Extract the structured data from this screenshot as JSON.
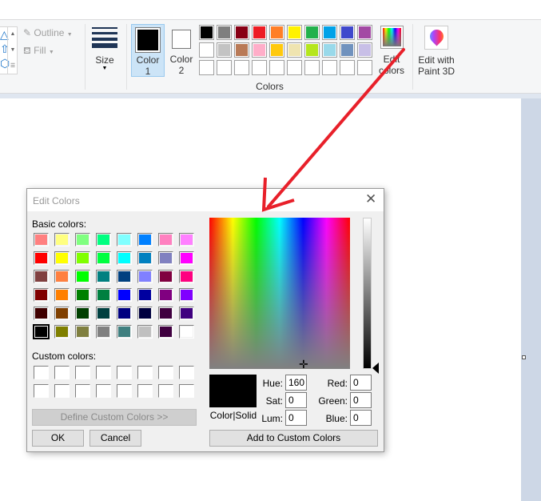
{
  "ribbon": {
    "outline_label": "Outline",
    "fill_label": "Fill",
    "size_label": "Size",
    "color1_label": [
      "Color",
      "1"
    ],
    "color2_label": [
      "Color",
      "2"
    ],
    "colors_group_label": "Colors",
    "edit_colors_label": [
      "Edit",
      "colors"
    ],
    "paint3d_label": [
      "Edit with",
      "Paint 3D"
    ],
    "color1": "#000000",
    "color2": "#ffffff",
    "palette": [
      [
        "#000000",
        "#7f7f7f",
        "#880015",
        "#ed1c24",
        "#ff7f27",
        "#fff200",
        "#22b14c",
        "#00a2e8",
        "#3f48cc",
        "#a349a4"
      ],
      [
        "#ffffff",
        "#c3c3c3",
        "#b97a57",
        "#ffaec9",
        "#ffc90e",
        "#efe4b0",
        "#b5e61d",
        "#99d9ea",
        "#7092be",
        "#c8bfe7"
      ],
      [
        "",
        "",
        "",
        "",
        "",
        "",
        "",
        "",
        "",
        ""
      ]
    ]
  },
  "dialog": {
    "title": "Edit Colors",
    "basic_colors_label": "Basic colors:",
    "basic_colors": [
      [
        "#ff8080",
        "#ffff80",
        "#80ff80",
        "#00ff80",
        "#80ffff",
        "#0080ff",
        "#ff80c0",
        "#ff80ff"
      ],
      [
        "#ff0000",
        "#ffff00",
        "#80ff00",
        "#00ff40",
        "#00ffff",
        "#0080c0",
        "#8080c0",
        "#ff00ff"
      ],
      [
        "#804040",
        "#ff8040",
        "#00ff00",
        "#008080",
        "#004080",
        "#8080ff",
        "#800040",
        "#ff0080"
      ],
      [
        "#800000",
        "#ff8000",
        "#008000",
        "#008040",
        "#0000ff",
        "#0000a0",
        "#800080",
        "#8000ff"
      ],
      [
        "#400000",
        "#804000",
        "#004000",
        "#004040",
        "#000080",
        "#000040",
        "#400040",
        "#400080"
      ],
      [
        "#000000",
        "#808000",
        "#808040",
        "#808080",
        "#408080",
        "#c0c0c0",
        "#400040",
        "#ffffff"
      ]
    ],
    "selected_basic": "#000000",
    "custom_colors_label": "Custom colors:",
    "define_button": "Define Custom Colors >>",
    "ok_button": "OK",
    "cancel_button": "Cancel",
    "preview_label": "Color|Solid",
    "hue_label": "Hue:",
    "hue": "160",
    "sat_label": "Sat:",
    "sat": "0",
    "lum_label": "Lum:",
    "lum": "0",
    "red_label": "Red:",
    "red": "0",
    "green_label": "Green:",
    "green": "0",
    "blue_label": "Blue:",
    "blue": "0",
    "add_button": "Add to Custom Colors",
    "current_color": "#000000"
  },
  "annotation_color": "#e8202a"
}
